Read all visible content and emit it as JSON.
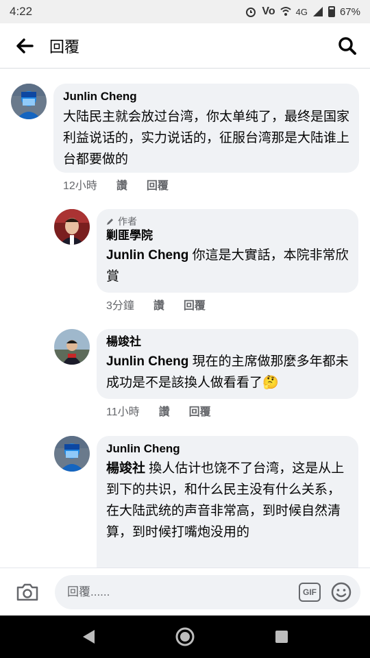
{
  "status_bar": {
    "time": "4:22",
    "network": "4G",
    "battery": "67%"
  },
  "header": {
    "title": "回覆"
  },
  "comments": [
    {
      "name": "Junlin Cheng",
      "text": "大陆民主就会放过台湾，你太单纯了，最终是国家利益说话的，实力说话的，征服台湾那是大陆谁上台都要做的",
      "time": "12小時",
      "like": "讚",
      "reply": "回覆"
    },
    {
      "author_tag": "作者",
      "name": "剿匪學院",
      "mention": "Junlin Cheng",
      "text": " 你這是大實話，本院非常欣賞",
      "time": "3分鐘",
      "like": "讚",
      "reply": "回覆"
    },
    {
      "name": "楊竣社",
      "mention": "Junlin Cheng",
      "text": " 現在的主席做那麼多年都未成功是不是該換人做看看了🤔",
      "time": "11小時",
      "like": "讚",
      "reply": "回覆"
    },
    {
      "name": "Junlin Cheng",
      "mention": "楊竣社",
      "text": " 換人估计也饶不了台湾，这是从上到下的共识，和什么民主没有什么关系，在大陆武统的声音非常高，到时候自然清算，到时候打嘴炮没用的"
    }
  ],
  "composer": {
    "placeholder": "回覆......",
    "gif_label": "GIF"
  },
  "icons": {
    "back": "back-arrow-icon",
    "search": "search-icon",
    "camera": "camera-icon",
    "emoji": "emoji-icon"
  },
  "colors": {
    "bubble": "#f0f2f5",
    "meta": "#65676b",
    "text": "#050505"
  }
}
